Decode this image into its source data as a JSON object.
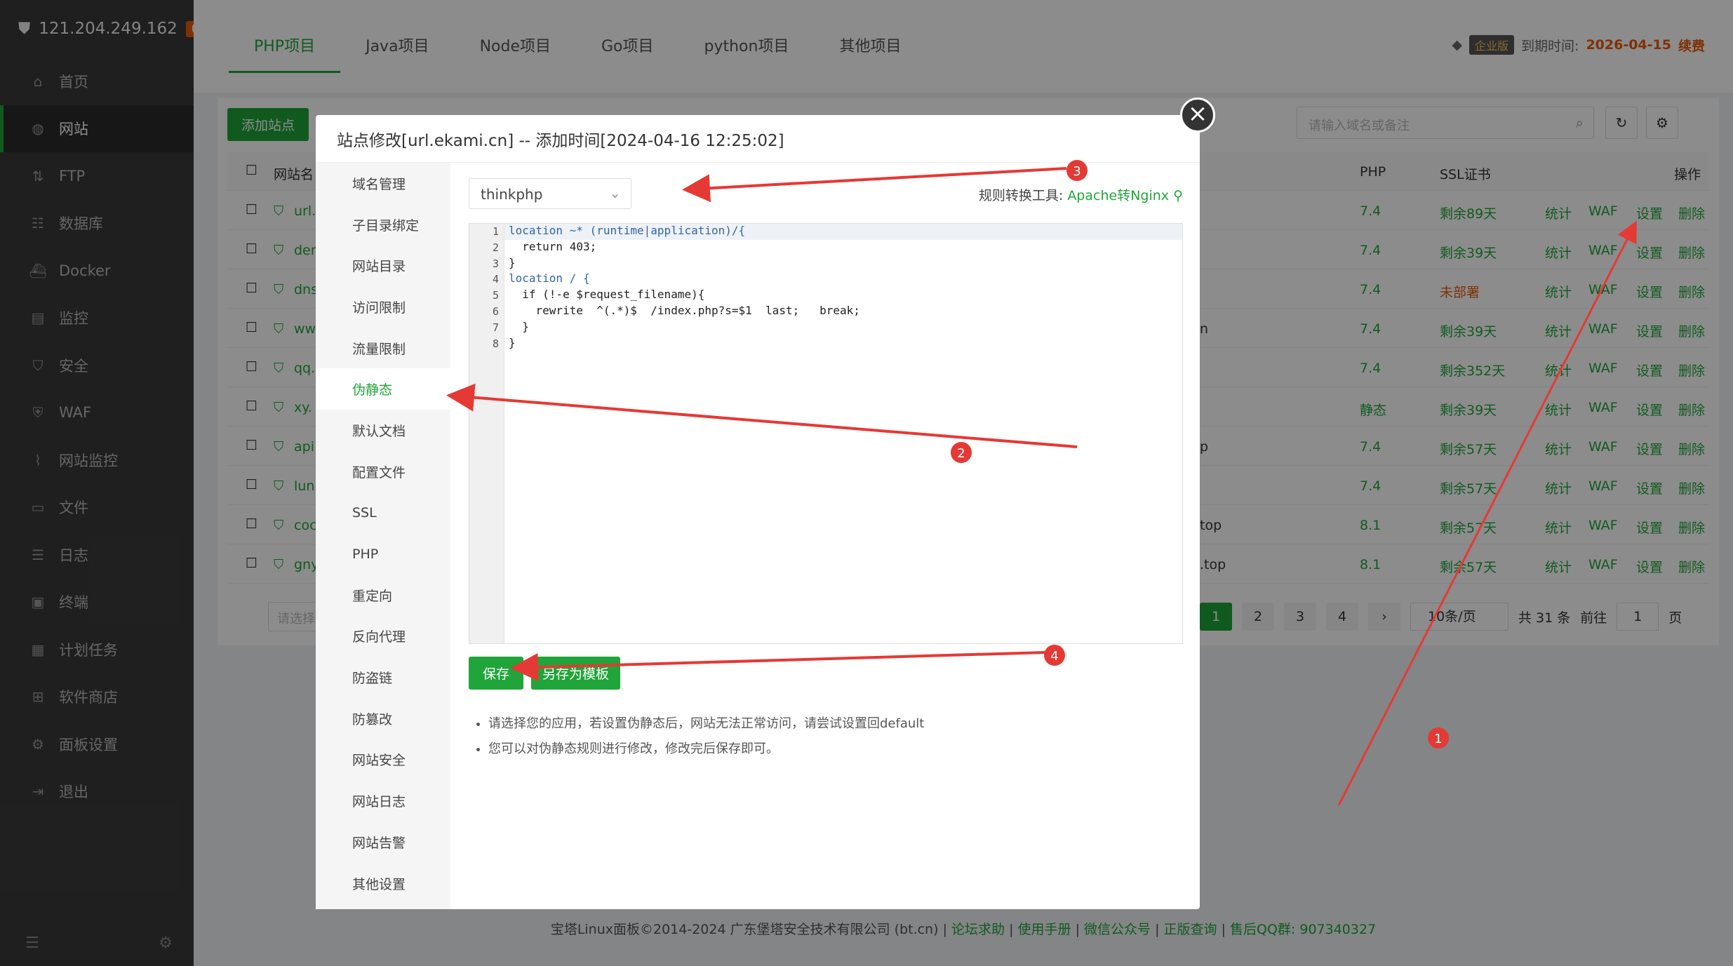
{
  "sidebar": {
    "ip": "121.204.249.162",
    "badge": "0",
    "items": [
      {
        "label": "首页",
        "icon": "home-icon"
      },
      {
        "label": "网站",
        "icon": "globe-icon"
      },
      {
        "label": "FTP",
        "icon": "ftp-icon"
      },
      {
        "label": "数据库",
        "icon": "database-icon"
      },
      {
        "label": "Docker",
        "icon": "docker-icon"
      },
      {
        "label": "监控",
        "icon": "monitor-icon"
      },
      {
        "label": "安全",
        "icon": "shield-icon"
      },
      {
        "label": "WAF",
        "icon": "waf-icon"
      },
      {
        "label": "网站监控",
        "icon": "chart-icon"
      },
      {
        "label": "文件",
        "icon": "folder-icon"
      },
      {
        "label": "日志",
        "icon": "log-icon"
      },
      {
        "label": "终端",
        "icon": "terminal-icon"
      },
      {
        "label": "计划任务",
        "icon": "calendar-icon"
      },
      {
        "label": "软件商店",
        "icon": "apps-icon"
      },
      {
        "label": "面板设置",
        "icon": "gear-icon"
      },
      {
        "label": "退出",
        "icon": "logout-icon"
      }
    ]
  },
  "tabs": [
    "PHP项目",
    "Java项目",
    "Node项目",
    "Go项目",
    "python项目",
    "其他项目"
  ],
  "topright": {
    "edition": "企业版",
    "expire_label": "到期时间:",
    "expire_date": "2026-04-15",
    "renew": "续费"
  },
  "toolbar": {
    "add_site": "添加站点",
    "search_placeholder": "请输入域名或备注"
  },
  "table": {
    "headers": {
      "name": "网站名",
      "php": "PHP",
      "ssl": "SSL证书",
      "ops": "操作"
    },
    "rows": [
      {
        "name": "url.",
        "php": "7.4",
        "ssl": "剩余89天"
      },
      {
        "name": "der",
        "php": "7.4",
        "ssl": "剩余39天"
      },
      {
        "name": "dns",
        "php": "7.4",
        "ssl": "未部署"
      },
      {
        "name": "ww",
        "php": "7.4",
        "ssl": "剩余39天"
      },
      {
        "name": "qq.",
        "php": "7.4",
        "ssl": "剩余352天"
      },
      {
        "name": "xy.",
        "php": "静态",
        "ssl": "剩余39天"
      },
      {
        "name": "api.",
        "php": "7.4",
        "ssl": "剩余57天"
      },
      {
        "name": "lun",
        "php": "7.4",
        "ssl": "剩余57天"
      },
      {
        "name": "coc",
        "php": "8.1",
        "ssl": "剩余57天"
      },
      {
        "name": "gny",
        "php": "8.1",
        "ssl": "剩余57天"
      }
    ],
    "ops": {
      "stat": "统计",
      "waf": "WAF",
      "set": "设置",
      "del": "删除"
    },
    "frag": [
      "n",
      "p",
      "top",
      ".top"
    ],
    "select_placeholder": "请选择",
    "pagination": {
      "pages": [
        "1",
        "2",
        "3",
        "4"
      ],
      "per_page": "10条/页",
      "total": "共 31 条",
      "goto": "前往",
      "page_value": "1",
      "page_unit": "页"
    }
  },
  "modal": {
    "title": "站点修改[url.ekami.cn] -- 添加时间[2024-04-16 12:25:02]",
    "nav": [
      "域名管理",
      "子目录绑定",
      "网站目录",
      "访问限制",
      "流量限制",
      "伪静态",
      "默认文档",
      "配置文件",
      "SSL",
      "PHP",
      "重定向",
      "反向代理",
      "防盗链",
      "防篡改",
      "网站安全",
      "网站日志",
      "网站告警",
      "其他设置"
    ],
    "select_value": "thinkphp",
    "tool_label": "规则转换工具:",
    "tool_link": "Apache转Nginx",
    "code_lines": [
      "location ~* (runtime|application)/{",
      "  return 403;",
      "}",
      "location / {",
      "  if (!-e $request_filename){",
      "    rewrite  ^(.*)$  /index.php?s=$1  last;   break;",
      "  }",
      "}"
    ],
    "line_numbers": [
      "1",
      "2",
      "3",
      "4",
      "5",
      "6",
      "7",
      "8"
    ],
    "save": "保存",
    "save_template": "另存为模板",
    "notes": [
      "请选择您的应用，若设置伪静态后，网站无法正常访问，请尝试设置回default",
      "您可以对伪静态规则进行修改，修改完后保存即可。"
    ]
  },
  "footer": {
    "copyright": "宝塔Linux面板©2014-2024 广东堡塔安全技术有限公司 (bt.cn)",
    "links": [
      "论坛求助",
      "使用手册",
      "微信公众号",
      "正版查询",
      "售后QQ群: 907340327"
    ]
  },
  "annotations": [
    "1",
    "2",
    "3",
    "4"
  ],
  "colors": {
    "accent": "#20a53a",
    "arrow": "#e53935"
  }
}
